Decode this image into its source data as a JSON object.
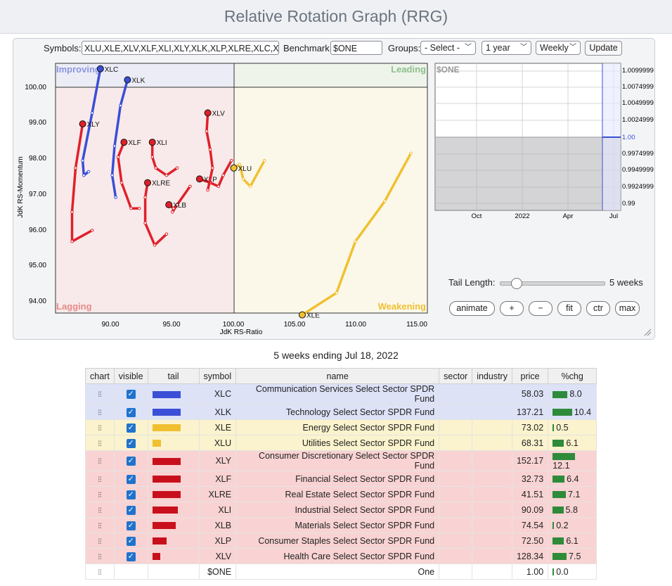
{
  "title": "Relative Rotation Graph (RRG)",
  "controls": {
    "symbols_label": "Symbols:",
    "symbols_value": "XLU,XLE,XLV,XLF,XLI,XLY,XLK,XLP,XLRE,XLC,XLB",
    "benchmark_label": "Benchmark:",
    "benchmark_value": "$ONE",
    "groups_label": "Groups:",
    "groups_value": "- Select -",
    "period_value": "1 year",
    "frequency_value": "Weekly",
    "update_label": "Update"
  },
  "rrg": {
    "quadrants": {
      "improving": "Improving",
      "leading": "Leading",
      "lagging": "Lagging",
      "weakening": "Weakening"
    },
    "xlabel": "JdK RS-Ratio",
    "ylabel": "JdK RS-Momentum",
    "x_ticks": [
      "90.00",
      "95.00",
      "100.00",
      "105.00",
      "110.00",
      "115.00"
    ],
    "y_ticks": [
      "100.00",
      "99.00",
      "98.00",
      "97.00",
      "96.00",
      "95.00",
      "94.00"
    ],
    "colors": {
      "improving": "#3a4fd6",
      "weakening": "#f0c030",
      "lagging": "#e0202a"
    }
  },
  "mini_chart": {
    "symbol": "$ONE",
    "y_ticks": [
      "1.0099999",
      "1.0074999",
      "1.0049999",
      "1.0024999",
      "1.00",
      "0.9974999",
      "0.9949999",
      "0.9924999",
      "0.99"
    ],
    "x_ticks": [
      "Oct",
      "2022",
      "Apr",
      "Jul"
    ]
  },
  "tail": {
    "label": "Tail Length:",
    "value": "5 weeks"
  },
  "buttons": {
    "animate": "animate",
    "plus": "+",
    "minus": "−",
    "fit": "fit",
    "ctr": "ctr",
    "max": "max"
  },
  "caption": "5 weeks ending Jul 18, 2022",
  "table": {
    "headers": {
      "chart": "chart",
      "visible": "visible",
      "tail": "tail",
      "symbol": "symbol",
      "name": "name",
      "sector": "sector",
      "industry": "industry",
      "price": "price",
      "chg": "%chg"
    },
    "rows": [
      {
        "symbol": "XLC",
        "name": "Communication Services Select Sector SPDR Fund",
        "price": "58.03",
        "chg": "8.0",
        "tail_color": "#3a4fd6",
        "tail_len": 40,
        "row_bg": "#dde2f7"
      },
      {
        "symbol": "XLK",
        "name": "Technology Select Sector SPDR Fund",
        "price": "137.21",
        "chg": "10.4",
        "tail_color": "#3a4fd6",
        "tail_len": 40,
        "row_bg": "#dde2f7"
      },
      {
        "symbol": "XLE",
        "name": "Energy Select Sector SPDR Fund",
        "price": "73.02",
        "chg": "0.5",
        "tail_color": "#f0c030",
        "tail_len": 40,
        "row_bg": "#fbf3cd"
      },
      {
        "symbol": "XLU",
        "name": "Utilities Select Sector SPDR Fund",
        "price": "68.31",
        "chg": "6.1",
        "tail_color": "#f0c030",
        "tail_len": 12,
        "row_bg": "#fbf3cd"
      },
      {
        "symbol": "XLY",
        "name": "Consumer Discretionary Select Sector SPDR Fund",
        "price": "152.17",
        "chg": "12.1",
        "tail_color": "#c8101c",
        "tail_len": 40,
        "row_bg": "#f9d3d3"
      },
      {
        "symbol": "XLF",
        "name": "Financial Select Sector SPDR Fund",
        "price": "32.73",
        "chg": "6.4",
        "tail_color": "#c8101c",
        "tail_len": 40,
        "row_bg": "#f9d3d3"
      },
      {
        "symbol": "XLRE",
        "name": "Real Estate Select Sector SPDR Fund",
        "price": "41.51",
        "chg": "7.1",
        "tail_color": "#c8101c",
        "tail_len": 40,
        "row_bg": "#f9d3d3"
      },
      {
        "symbol": "XLI",
        "name": "Industrial Select Sector SPDR Fund",
        "price": "90.09",
        "chg": "5.8",
        "tail_color": "#c8101c",
        "tail_len": 36,
        "row_bg": "#f9d3d3"
      },
      {
        "symbol": "XLB",
        "name": "Materials Select Sector SPDR Fund",
        "price": "74.54",
        "chg": "0.2",
        "tail_color": "#c8101c",
        "tail_len": 33,
        "row_bg": "#f9d3d3"
      },
      {
        "symbol": "XLP",
        "name": "Consumer Staples Select Sector SPDR Fund",
        "price": "72.50",
        "chg": "6.1",
        "tail_color": "#c8101c",
        "tail_len": 20,
        "row_bg": "#f9d3d3"
      },
      {
        "symbol": "XLV",
        "name": "Health Care Select Sector SPDR Fund",
        "price": "128.34",
        "chg": "7.5",
        "tail_color": "#c8101c",
        "tail_len": 11,
        "row_bg": "#f9d3d3"
      },
      {
        "symbol": "$ONE",
        "name": "One",
        "price": "1.00",
        "chg": "0.0",
        "tail_color": "",
        "tail_len": 0,
        "row_bg": "#ffffff",
        "no_checkbox": true
      }
    ]
  },
  "chart_data": {
    "type": "scatter",
    "xlabel": "JdK RS-Ratio",
    "ylabel": "JdK RS-Momentum",
    "xlim": [
      85.0,
      116.5
    ],
    "ylim": [
      93.85,
      100.65
    ],
    "x_ticks": [
      90,
      95,
      100,
      105,
      110,
      115
    ],
    "y_ticks": [
      94,
      95,
      96,
      97,
      98,
      99,
      100
    ],
    "center": [
      100,
      100
    ],
    "series": [
      {
        "name": "XLC",
        "color": "#3a4fd6",
        "points": [
          [
            87.8,
            97.7
          ],
          [
            87.4,
            97.6
          ],
          [
            87.3,
            98.0
          ],
          [
            88.1,
            99.3
          ],
          [
            88.8,
            100.5
          ]
        ]
      },
      {
        "name": "XLK",
        "color": "#3a4fd6",
        "points": [
          [
            90.1,
            97.0
          ],
          [
            89.8,
            97.6
          ],
          [
            90.0,
            98.4
          ],
          [
            90.5,
            99.5
          ],
          [
            91.1,
            100.2
          ]
        ]
      },
      {
        "name": "XLE",
        "color": "#f0c030",
        "points": [
          [
            115.1,
            98.2
          ],
          [
            112.9,
            96.9
          ],
          [
            110.4,
            95.8
          ],
          [
            108.8,
            94.4
          ],
          [
            105.9,
            93.8
          ]
        ]
      },
      {
        "name": "XLU",
        "color": "#f0c030",
        "points": [
          [
            102.7,
            98.0
          ],
          [
            101.5,
            97.3
          ],
          [
            100.9,
            97.5
          ],
          [
            100.6,
            97.9
          ],
          [
            100.1,
            97.8
          ]
        ]
      },
      {
        "name": "XLY",
        "color": "#e0202a",
        "points": [
          [
            88.1,
            96.1
          ],
          [
            86.4,
            95.8
          ],
          [
            86.4,
            96.6
          ],
          [
            86.7,
            97.8
          ],
          [
            87.3,
            99.0
          ]
        ]
      },
      {
        "name": "XLF",
        "color": "#e0202a",
        "points": [
          [
            92.1,
            96.7
          ],
          [
            91.4,
            96.7
          ],
          [
            90.6,
            97.4
          ],
          [
            90.3,
            98.1
          ],
          [
            90.8,
            98.5
          ]
        ]
      },
      {
        "name": "XLRE",
        "color": "#e0202a",
        "points": [
          [
            94.4,
            96.0
          ],
          [
            93.4,
            95.7
          ],
          [
            92.6,
            96.3
          ],
          [
            92.6,
            97.0
          ],
          [
            92.8,
            97.4
          ]
        ]
      },
      {
        "name": "XLI",
        "color": "#e0202a",
        "points": [
          [
            95.3,
            97.8
          ],
          [
            94.4,
            97.6
          ],
          [
            93.5,
            97.8
          ],
          [
            93.2,
            98.1
          ],
          [
            93.2,
            98.5
          ]
        ]
      },
      {
        "name": "XLB",
        "color": "#e0202a",
        "points": [
          [
            96.4,
            97.3
          ],
          [
            95.3,
            96.8
          ],
          [
            94.9,
            96.6
          ],
          [
            95.0,
            96.7
          ],
          [
            94.6,
            96.8
          ]
        ]
      },
      {
        "name": "XLP",
        "color": "#e0202a",
        "points": [
          [
            99.9,
            98.0
          ],
          [
            99.2,
            97.6
          ],
          [
            98.8,
            97.3
          ],
          [
            98.1,
            97.4
          ],
          [
            97.2,
            97.5
          ]
        ]
      },
      {
        "name": "XLV",
        "color": "#e0202a",
        "points": [
          [
            97.9,
            97.2
          ],
          [
            98.3,
            97.8
          ],
          [
            98.1,
            98.3
          ],
          [
            97.8,
            98.8
          ],
          [
            97.9,
            99.3
          ]
        ]
      }
    ]
  }
}
